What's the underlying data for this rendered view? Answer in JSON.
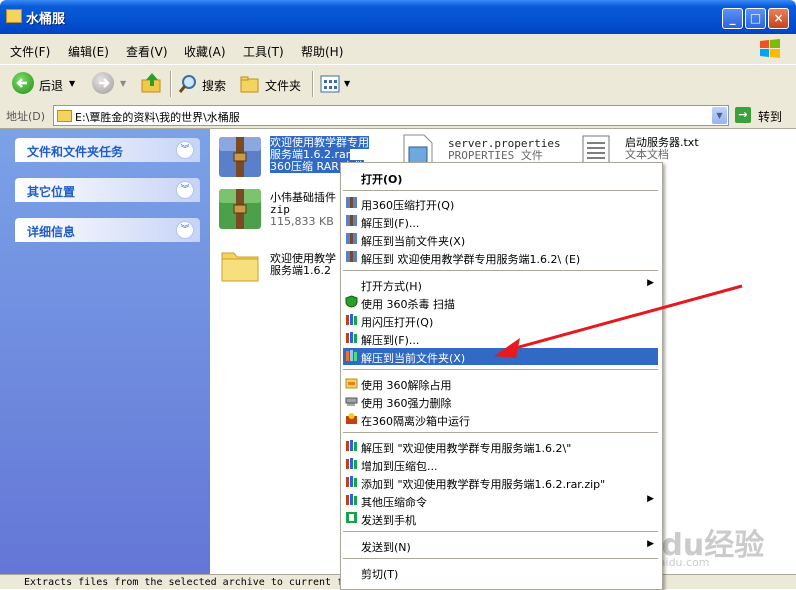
{
  "window": {
    "title": "水桶服",
    "min_label": "_",
    "max_label": "□",
    "close_label": "×"
  },
  "menu": [
    "文件(F)",
    "编辑(E)",
    "查看(V)",
    "收藏(A)",
    "工具(T)",
    "帮助(H)"
  ],
  "toolbar": {
    "back_label": "后退",
    "search_label": "搜索",
    "folders_label": "文件夹"
  },
  "address": {
    "label": "地址(D)",
    "path": "E:\\覃胜金的资料\\我的世界\\水桶服",
    "go_label": "转到"
  },
  "tasks": [
    "文件和文件夹任务",
    "其它位置",
    "详细信息"
  ],
  "files": {
    "rar1": {
      "line1": "欢迎使用教学群专用",
      "line2": "服务端1.6.2.rar",
      "line3": "360压缩 RAR 文件"
    },
    "props": {
      "line1": "server.properties",
      "line2": "PROPERTIES 文件"
    },
    "txt": {
      "line1": "启动服务器.txt",
      "line2": "文本文档"
    },
    "zip": {
      "line1": "小伟基础插件",
      "line2": "zip",
      "line3": "115,833 KB"
    },
    "folder": {
      "line1": "欢迎使用教学",
      "line2": "服务端1.6.2"
    }
  },
  "context_menu": [
    {
      "label": "打开(O)",
      "bold": true
    },
    {
      "label": "用360压缩打开(Q)"
    },
    {
      "label": "解压到(F)..."
    },
    {
      "label": "解压到当前文件夹(X)"
    },
    {
      "label": "解压到 欢迎使用教学群专用服务端1.6.2\\ (E)"
    },
    {
      "label": "打开方式(H)",
      "arrow": "▶"
    },
    {
      "label": "使用 360杀毒 扫描"
    },
    {
      "label": "用闪压打开(Q)"
    },
    {
      "label": "解压到(F)..."
    },
    {
      "label": "解压到当前文件夹(X)",
      "highlight": true
    },
    {
      "label": "使用 360解除占用"
    },
    {
      "label": "使用 360强力删除"
    },
    {
      "label": "在360隔离沙箱中运行"
    },
    {
      "label": "解压到 \"欢迎使用教学群专用服务端1.6.2\\\""
    },
    {
      "label": "增加到压缩包..."
    },
    {
      "label": "添加到 \"欢迎使用教学群专用服务端1.6.2.rar.zip\""
    },
    {
      "label": "其他压缩命令",
      "arrow": "▶"
    },
    {
      "label": "发送到手机"
    },
    {
      "label": "发送到(N)",
      "arrow": "▶"
    },
    {
      "label": "剪切(T)"
    }
  ],
  "status": {
    "text": "Extracts files from the selected archive to current f"
  },
  "watermark": {
    "main": "Baidu经验",
    "sub": "jingyan.baidu.com"
  },
  "colors": {
    "title_blue": "#0452d2",
    "task_pane": "#6f8fe0",
    "highlight": "#316ac5",
    "arrow_red": "#e5191e"
  }
}
